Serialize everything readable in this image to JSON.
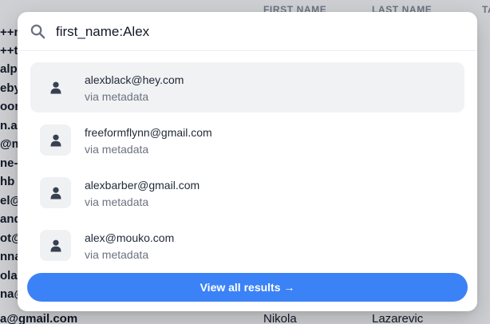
{
  "background": {
    "headers": [
      "FIRST NAME",
      "LAST NAME",
      "TA"
    ],
    "email_fragments": [
      "++n",
      "++te",
      "alpc",
      "eby",
      "oon",
      "n.a",
      "@m",
      "ne-",
      "hb",
      "el@",
      "and",
      "ot@",
      "nna",
      "olac",
      "na@"
    ],
    "bottom_row": {
      "email": "a@gmail.com",
      "first_name": "Nikola",
      "last_name": "Lazarevic"
    }
  },
  "search": {
    "value": "first_name:Alex",
    "icon": "search-icon"
  },
  "results": [
    {
      "title": "alexblack@hey.com",
      "subtitle": "via metadata",
      "icon": "user-icon",
      "active": true
    },
    {
      "title": "freeformflynn@gmail.com",
      "subtitle": "via metadata",
      "icon": "user-icon",
      "active": false
    },
    {
      "title": "alexbarber@gmail.com",
      "subtitle": "via metadata",
      "icon": "user-icon",
      "active": false
    },
    {
      "title": "alex@mouko.com",
      "subtitle": "via metadata",
      "icon": "user-icon",
      "active": false
    }
  ],
  "view_all": {
    "label": "View all results →"
  },
  "colors": {
    "accent": "#3b82f6",
    "active_row": "#f1f2f4"
  }
}
